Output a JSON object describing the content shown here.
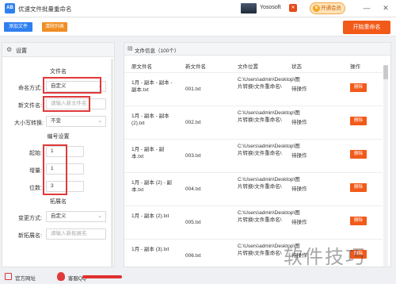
{
  "window": {
    "title": "优速文件批量重命名",
    "logo_text": "AB",
    "user_name": "Yososoft",
    "user_badge": "✕",
    "vip_label": "开通会员",
    "crown_icon": "♛",
    "minimize": "—",
    "close": "✕"
  },
  "toolbar": {
    "add_file": "添加文件",
    "clear_list": "清除列表",
    "start_rename": "开始重命名"
  },
  "settings": {
    "title": "设置",
    "gear_icon": "⚙",
    "filename_section": "文件名",
    "naming_label": "命名方式:",
    "naming_value": "自定义",
    "new_name_label": "新文件名:",
    "new_name_placeholder": "请输入新文件名",
    "case_label": "大小写转换:",
    "case_value": "不变",
    "number_section": "编号设置",
    "start_label": "起始:",
    "start_value": "1",
    "increment_label": "增量:",
    "increment_value": "1",
    "digits_label": "位数:",
    "digits_value": "3",
    "ext_section": "拓展名",
    "ext_mode_label": "变更方式:",
    "ext_mode_value": "自定义",
    "new_ext_label": "新拓展名:",
    "new_ext_placeholder": "请输入新拓展名"
  },
  "file_list": {
    "title": "文件信息（100个）",
    "columns": [
      "原文件名",
      "新文件名",
      "文件位置",
      "状态",
      "操作"
    ],
    "delete_label": "删除",
    "rows": [
      {
        "original": "1月 - 副本 - 副本 - 副本.txt",
        "new": "001.txt",
        "location": "C:\\Users\\admin\\Desktop\\图片转换\\文件重命名\\",
        "status": "待操作"
      },
      {
        "original": "1月 - 副本 - 副本 (2).txt",
        "new": "002.txt",
        "location": "C:\\Users\\admin\\Desktop\\图片转换\\文件重命名\\",
        "status": "待操作"
      },
      {
        "original": "1月 - 副本 - 副本.txt",
        "new": "003.txt",
        "location": "C:\\Users\\admin\\Desktop\\图片转换\\文件重命名\\",
        "status": "待操作"
      },
      {
        "original": "1月 - 副本 (2) - 副本.txt",
        "new": "004.txt",
        "location": "C:\\Users\\admin\\Desktop\\图片转换\\文件重命名\\",
        "status": "待操作"
      },
      {
        "original": "1月 - 副本 (2).txt",
        "new": "005.txt",
        "location": "C:\\Users\\admin\\Desktop\\图片转换\\文件重命名\\",
        "status": "待操作"
      },
      {
        "original": "1月 - 副本 (3).txt",
        "new": "006.txt",
        "location": "C:\\Users\\admin\\Desktop\\图片转换\\文件重命名\\",
        "status": "待操作"
      }
    ]
  },
  "footer": {
    "homepage": "官方网址",
    "support": "客服QQ"
  },
  "watermark": "软件技巧"
}
